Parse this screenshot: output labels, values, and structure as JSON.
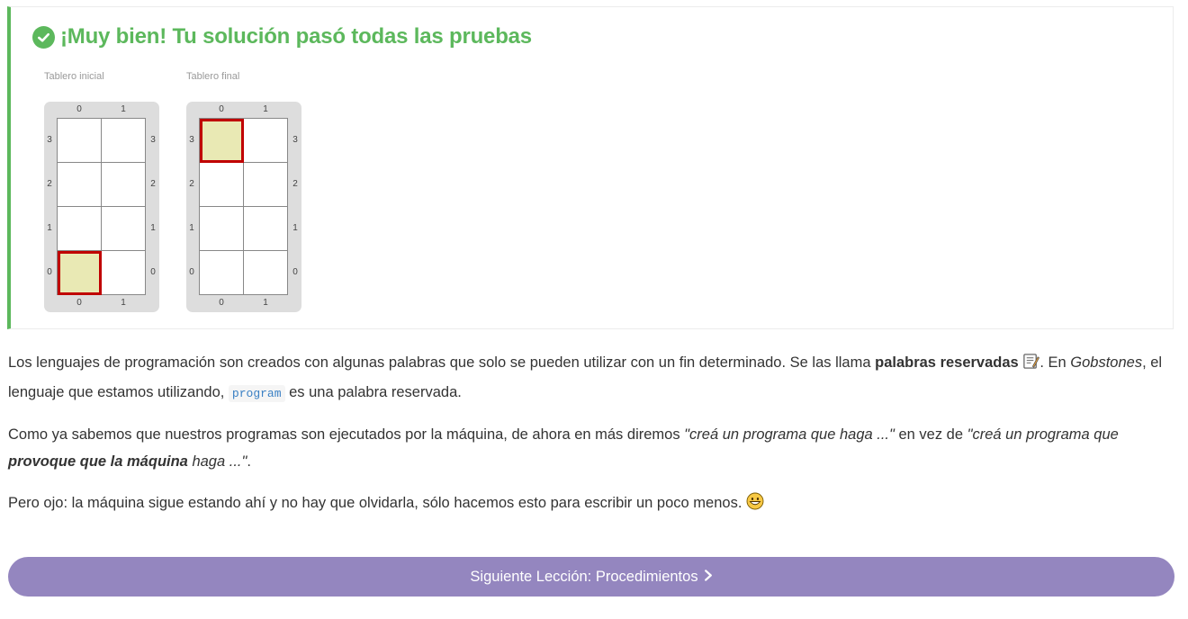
{
  "result": {
    "title": "¡Muy bien! Tu solución pasó todas las pruebas",
    "status_color": "#5cb85c"
  },
  "boards": [
    {
      "label": "Tablero inicial",
      "cols": [
        "0",
        "1"
      ],
      "rows": [
        "3",
        "2",
        "1",
        "0"
      ],
      "head": {
        "x": 0,
        "y": 0
      }
    },
    {
      "label": "Tablero final",
      "cols": [
        "0",
        "1"
      ],
      "rows": [
        "3",
        "2",
        "1",
        "0"
      ],
      "head": {
        "x": 0,
        "y": 3
      }
    }
  ],
  "content": {
    "p1": {
      "a": "Los lenguajes de programación son creados con algunas palabras que solo se pueden utilizar con un fin determinado. Se las llama ",
      "b": "palabras reservadas",
      "c": ". En ",
      "d": "Gobstones",
      "e": ", el lenguaje que estamos utilizando, ",
      "code": "program",
      "f": " es una palabra reservada."
    },
    "p2": {
      "a": "Como ya sabemos que nuestros programas son ejecutados por la máquina, de ahora en más diremos ",
      "b": "\"creá un programa que haga ...\"",
      "c": " en vez de ",
      "d": "\"creá un programa que ",
      "e": "provoque que la máquina",
      "f": " haga ...\"",
      "g": "."
    },
    "p3": {
      "a": "Pero ojo: la máquina sigue estando ahí y no hay que olvidarla, sólo hacemos esto para escribir un poco menos. "
    }
  },
  "next_button": {
    "label": "Siguiente Lección: Procedimientos",
    "color": "#9486bf"
  }
}
